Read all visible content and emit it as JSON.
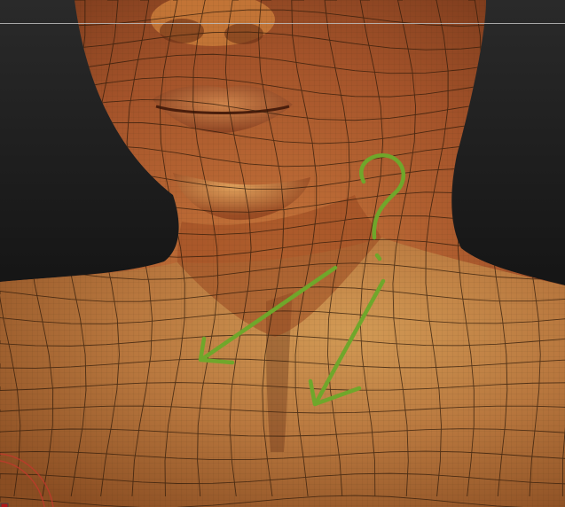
{
  "viewport": {
    "background_top": "#2a2a2a",
    "background_bottom": "#050505",
    "top_line_color": "#bdbdbd"
  },
  "model": {
    "subject": "sculpted-neck-and-lower-face",
    "skin_base": "#b9602c",
    "skin_highlight": "#d98a4a",
    "skin_shadow": "#5a2a12",
    "wire_color": "#3a2410"
  },
  "annotations": {
    "color": "#6fa72b",
    "symbols": [
      "question-mark",
      "arrow",
      "arrow"
    ]
  },
  "corner_indicator": {
    "fill": "#b01818"
  }
}
